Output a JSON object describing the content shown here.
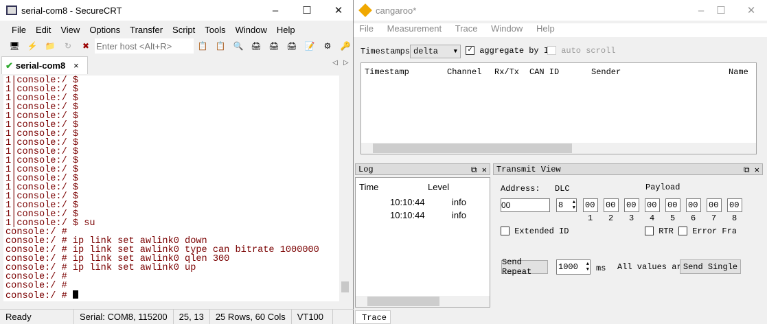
{
  "securecrt": {
    "title": "serial-com8 - SecureCRT",
    "menu": [
      "File",
      "Edit",
      "View",
      "Options",
      "Transfer",
      "Script",
      "Tools",
      "Window",
      "Help"
    ],
    "host_placeholder": "Enter host <Alt+R>",
    "tab": "serial-com8",
    "terminal_lines": [
      "1|console:/ $",
      "1|console:/ $",
      "1|console:/ $",
      "1|console:/ $",
      "1|console:/ $",
      "1|console:/ $",
      "1|console:/ $",
      "1|console:/ $",
      "1|console:/ $",
      "1|console:/ $",
      "1|console:/ $",
      "1|console:/ $",
      "1|console:/ $",
      "1|console:/ $",
      "1|console:/ $",
      "1|console:/ $",
      "1|console:/ $ su",
      "console:/ #",
      "console:/ # ip link set awlink0 down",
      "console:/ # ip link set awlink0 type can bitrate 1000000",
      "console:/ # ip link set awlink0 qlen 300",
      "console:/ # ip link set awlink0 up",
      "console:/ #",
      "console:/ #",
      "console:/ # "
    ],
    "status": {
      "ready": "Ready",
      "connection": "Serial: COM8, 115200",
      "cursor": "25,  13",
      "size": "25 Rows, 60 Cols",
      "emulation": "VT100"
    }
  },
  "cangaroo": {
    "title": "cangaroo*",
    "menu": [
      "File",
      "Measurement",
      "Trace",
      "Window",
      "Help"
    ],
    "timestamps_label": "Timestamps:",
    "timestamps_value": "delta",
    "aggregate_label": "aggregate by ID",
    "aggregate_checked": true,
    "autoscroll_label": "auto scroll",
    "autoscroll_checked": false,
    "trace_columns": [
      "Timestamp",
      "Channel",
      "Rx/Tx",
      "CAN ID",
      "Sender",
      "Name"
    ],
    "log": {
      "title": "Log",
      "columns": [
        "Time",
        "Level"
      ],
      "rows": [
        {
          "time": "10:10:44",
          "level": "info"
        },
        {
          "time": "10:10:44",
          "level": "info"
        }
      ]
    },
    "transmit": {
      "title": "Transmit View",
      "address_label": "Address:",
      "address": "00",
      "dlc_label": "DLC",
      "dlc": "8",
      "payload_label": "Payload",
      "payload": [
        "00",
        "00",
        "00",
        "00",
        "00",
        "00",
        "00",
        "00"
      ],
      "byte_labels": [
        "1",
        "2",
        "3",
        "4",
        "5",
        "6",
        "7",
        "8"
      ],
      "extended_id": "Extended ID",
      "rtr": "RTR",
      "error_frame": "Error Fram",
      "send_repeat": "Send Repeat",
      "interval": "1000",
      "ms": "ms",
      "all_values": "All values are ",
      "send_single": "Send Single"
    },
    "bottom_tab": "Trace"
  }
}
